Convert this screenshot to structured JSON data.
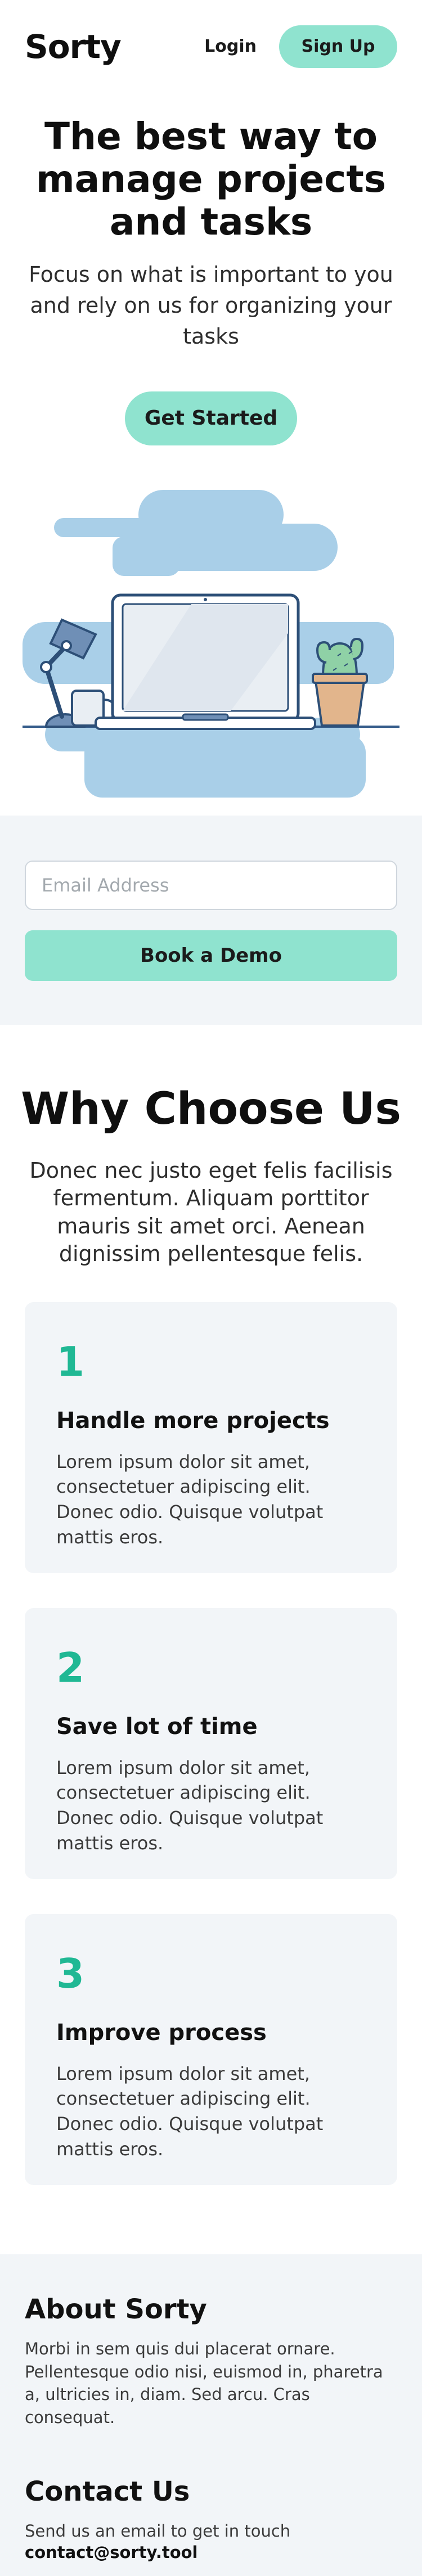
{
  "header": {
    "logo": "Sorty",
    "login_label": "Login",
    "signup_label": "Sign Up"
  },
  "hero": {
    "title": "The best way to manage projects and tasks",
    "subtitle": "Focus on what is important to you and rely on us for organizing your tasks",
    "cta_label": "Get Started"
  },
  "demo": {
    "email_placeholder": "Email Address",
    "email_value": "",
    "button_label": "Book a Demo"
  },
  "features": {
    "title": "Why Choose Us",
    "subtitle": "Donec nec justo eget felis facilisis fermentum. Aliquam porttitor mauris sit amet orci. Aenean dignissim pellentesque felis.",
    "cards": [
      {
        "number": "1",
        "title": "Handle more projects",
        "text": "Lorem ipsum dolor sit amet, consectetuer adipiscing elit. Donec odio. Quisque volutpat mattis eros."
      },
      {
        "number": "2",
        "title": "Save lot of time",
        "text": "Lorem ipsum dolor sit amet, consectetuer adipiscing elit. Donec odio. Quisque volutpat mattis eros."
      },
      {
        "number": "3",
        "title": "Improve process",
        "text": "Lorem ipsum dolor sit amet, consectetuer adipiscing elit. Donec odio. Quisque volutpat mattis eros."
      }
    ]
  },
  "footer": {
    "about_title": "About Sorty",
    "about_text": "Morbi in sem quis dui placerat ornare. Pellentesque odio nisi, euismod in, pharetra a, ultricies in, diam. Sed arcu. Cras consequat.",
    "contact_title": "Contact Us",
    "contact_text": "Send us an email to get in touch",
    "contact_email": "contact@sorty.tool"
  },
  "colors": {
    "accent": "#8fe3cf",
    "number": "#20b894",
    "section_bg": "#f2f5f8",
    "illustration_blue": "#a9cfe8"
  },
  "icons": [
    "desk-illustration",
    "laptop-icon",
    "desk-lamp-icon",
    "mug-icon",
    "cactus-icon"
  ]
}
